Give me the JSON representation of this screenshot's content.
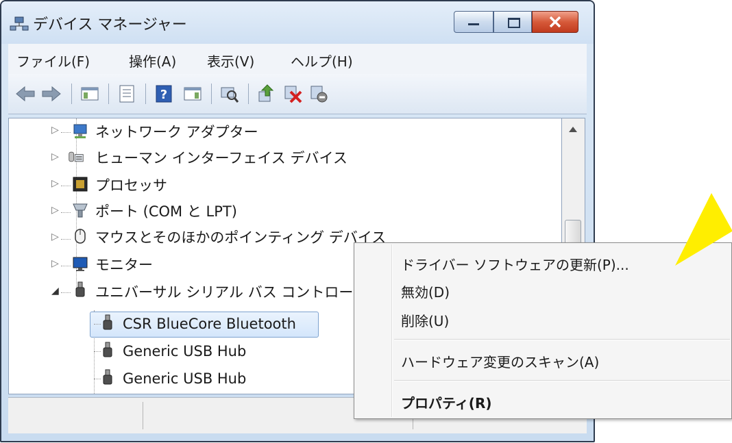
{
  "window": {
    "title": "デバイス マネージャー"
  },
  "menu": [
    "ファイル(F)",
    "操作(A)",
    "表示(V)",
    "ヘルプ(H)"
  ],
  "toolbar_icons": [
    "back-icon",
    "forward-icon",
    "show-hide-console-tree-icon",
    "properties-icon",
    "help-icon",
    "action-pane-icon",
    "scan-hardware-icon",
    "update-driver-icon",
    "uninstall-icon",
    "disable-icon"
  ],
  "tree": {
    "categories": [
      {
        "label": "ネットワーク アダプター",
        "icon": "network-adapter-icon",
        "expanded": false
      },
      {
        "label": "ヒューマン インターフェイス デバイス",
        "icon": "hid-icon",
        "expanded": false
      },
      {
        "label": "プロセッサ",
        "icon": "processor-icon",
        "expanded": false
      },
      {
        "label": "ポート (COM と LPT)",
        "icon": "port-icon",
        "expanded": false
      },
      {
        "label": "マウスとそのほかのポインティング デバイス",
        "icon": "mouse-icon",
        "expanded": false
      },
      {
        "label": "モニター",
        "icon": "monitor-icon",
        "expanded": false
      },
      {
        "label": "ユニバーサル シリアル バス コントローラー",
        "icon": "usb-icon",
        "expanded": true
      }
    ],
    "children": [
      {
        "label": "CSR BlueCore Bluetooth",
        "selected": true
      },
      {
        "label": "Generic USB Hub",
        "selected": false
      },
      {
        "label": "Generic USB Hub",
        "selected": false
      }
    ]
  },
  "context_menu": {
    "items": [
      "ドライバー ソフトウェアの更新(P)...",
      "無効(D)",
      "削除(U)",
      "ハードウェア変更のスキャン(A)",
      "プロパティ(R)"
    ],
    "bold_item": "プロパティ(R)"
  },
  "colors": {
    "accent_arrow": "#ffee00",
    "selection": "#d4e6fb",
    "close_button": "#d65a3a"
  }
}
